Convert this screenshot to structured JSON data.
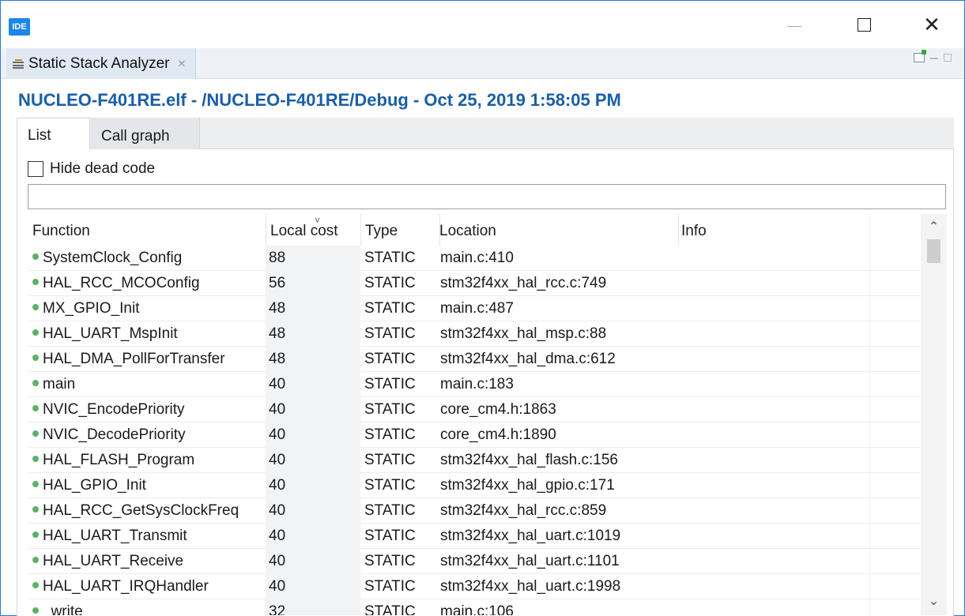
{
  "window": {
    "app_icon_label": "IDE"
  },
  "view": {
    "tab_label": "Static Stack Analyzer",
    "tab_close_glyph": "✕"
  },
  "header": {
    "title": "NUCLEO-F401RE.elf - /NUCLEO-F401RE/Debug - Oct 25, 2019 1:58:05 PM"
  },
  "subtabs": {
    "list": "List",
    "call_graph": "Call graph"
  },
  "filter": {
    "hide_dead_code_label": "Hide dead code",
    "hide_dead_code_checked": false,
    "value": ""
  },
  "table": {
    "columns": {
      "function": "Function",
      "local_cost": "Local cost",
      "type": "Type",
      "location": "Location",
      "info": "Info"
    },
    "rows": [
      {
        "function": "SystemClock_Config",
        "local_cost": "88",
        "type": "STATIC",
        "location": "main.c:410",
        "info": ""
      },
      {
        "function": "HAL_RCC_MCOConfig",
        "local_cost": "56",
        "type": "STATIC",
        "location": "stm32f4xx_hal_rcc.c:749",
        "info": ""
      },
      {
        "function": "MX_GPIO_Init",
        "local_cost": "48",
        "type": "STATIC",
        "location": "main.c:487",
        "info": ""
      },
      {
        "function": "HAL_UART_MspInit",
        "local_cost": "48",
        "type": "STATIC",
        "location": "stm32f4xx_hal_msp.c:88",
        "info": ""
      },
      {
        "function": "HAL_DMA_PollForTransfer",
        "local_cost": "48",
        "type": "STATIC",
        "location": "stm32f4xx_hal_dma.c:612",
        "info": ""
      },
      {
        "function": "main",
        "local_cost": "40",
        "type": "STATIC",
        "location": "main.c:183",
        "info": ""
      },
      {
        "function": "NVIC_EncodePriority",
        "local_cost": "40",
        "type": "STATIC",
        "location": "core_cm4.h:1863",
        "info": ""
      },
      {
        "function": "NVIC_DecodePriority",
        "local_cost": "40",
        "type": "STATIC",
        "location": "core_cm4.h:1890",
        "info": ""
      },
      {
        "function": "HAL_FLASH_Program",
        "local_cost": "40",
        "type": "STATIC",
        "location": "stm32f4xx_hal_flash.c:156",
        "info": ""
      },
      {
        "function": "HAL_GPIO_Init",
        "local_cost": "40",
        "type": "STATIC",
        "location": "stm32f4xx_hal_gpio.c:171",
        "info": ""
      },
      {
        "function": "HAL_RCC_GetSysClockFreq",
        "local_cost": "40",
        "type": "STATIC",
        "location": "stm32f4xx_hal_rcc.c:859",
        "info": ""
      },
      {
        "function": "HAL_UART_Transmit",
        "local_cost": "40",
        "type": "STATIC",
        "location": "stm32f4xx_hal_uart.c:1019",
        "info": ""
      },
      {
        "function": "HAL_UART_Receive",
        "local_cost": "40",
        "type": "STATIC",
        "location": "stm32f4xx_hal_uart.c:1101",
        "info": ""
      },
      {
        "function": "HAL_UART_IRQHandler",
        "local_cost": "40",
        "type": "STATIC",
        "location": "stm32f4xx_hal_uart.c:1998",
        "info": ""
      },
      {
        "function": "_write",
        "local_cost": "32",
        "type": "STATIC",
        "location": "main.c:106",
        "info": ""
      }
    ]
  },
  "colors": {
    "title_blue": "#1a5ea8",
    "window_border": "#2b7bd6",
    "status_dot_green": "#5db06a"
  },
  "icons": {
    "app": "ide-logo-icon",
    "view_tab": "stack-analyzer-icon",
    "row_marker": "green-dot-icon",
    "sort": "sort-arrow-icon"
  }
}
